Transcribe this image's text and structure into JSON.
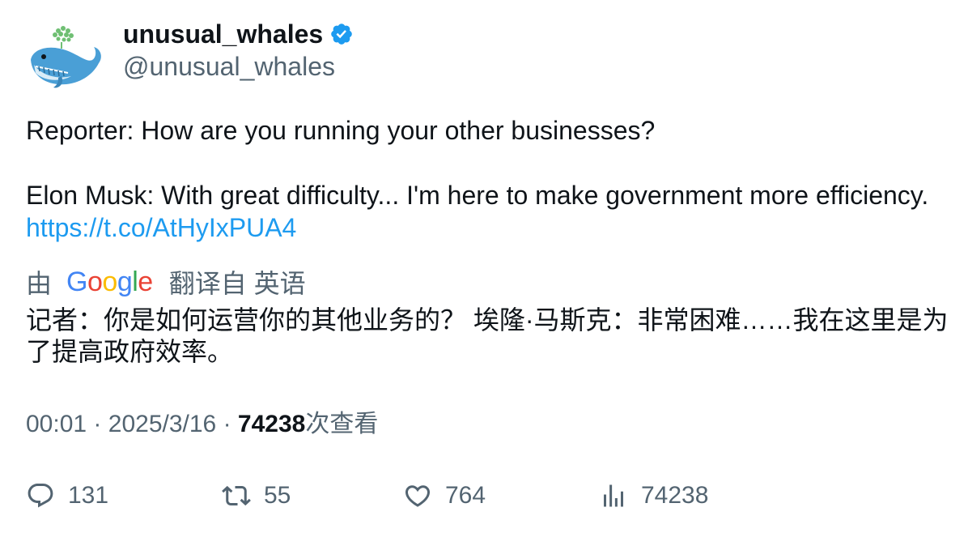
{
  "author": {
    "display_name": "unusual_whales",
    "handle": "@unusual_whales",
    "verified": true,
    "avatar_icon": "whale-logo-icon"
  },
  "tweet": {
    "line1": "Reporter: How are you running your other businesses?",
    "line2": "Elon Musk: With great difficulty... I'm here to make government more efficiency.",
    "link": "https://t.co/AtHyIxPUA4"
  },
  "translation": {
    "prefix": "由",
    "provider_letters": [
      "G",
      "o",
      "o",
      "g",
      "l",
      "e"
    ],
    "suffix": "翻译自 英语",
    "text": "记者：你是如何运营你的其他业务的？ 埃隆·马斯克：非常困难……我在这里是为了提高政府效率。"
  },
  "meta": {
    "time": "00:01",
    "separator": "·",
    "date": "2025/3/16",
    "views_count": "74238",
    "views_label": "次查看"
  },
  "actions": {
    "replies": "131",
    "retweets": "55",
    "likes": "764",
    "views": "74238"
  },
  "colors": {
    "text": "#0f1419",
    "secondary": "#536471",
    "link": "#1d9bf0",
    "verified": "#1d9bf0"
  }
}
